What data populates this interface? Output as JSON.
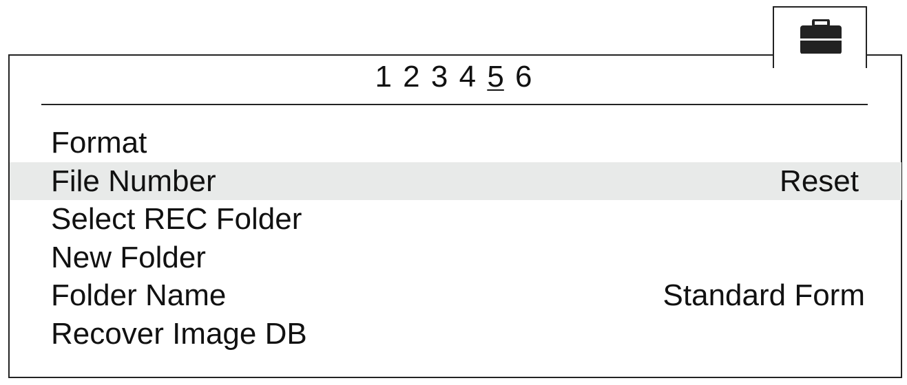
{
  "tab": {
    "icon": "toolbox-icon"
  },
  "pages": {
    "numbers": [
      "1",
      "2",
      "3",
      "4",
      "5",
      "6"
    ],
    "active": "5"
  },
  "menu": {
    "items": [
      {
        "label": "Format",
        "value": ""
      },
      {
        "label": "File Number",
        "value": "Reset"
      },
      {
        "label": "Select REC Folder",
        "value": ""
      },
      {
        "label": "New Folder",
        "value": ""
      },
      {
        "label": "Folder Name",
        "value": "Standard Form"
      },
      {
        "label": "Recover Image DB",
        "value": ""
      }
    ],
    "selected_index": 1
  }
}
